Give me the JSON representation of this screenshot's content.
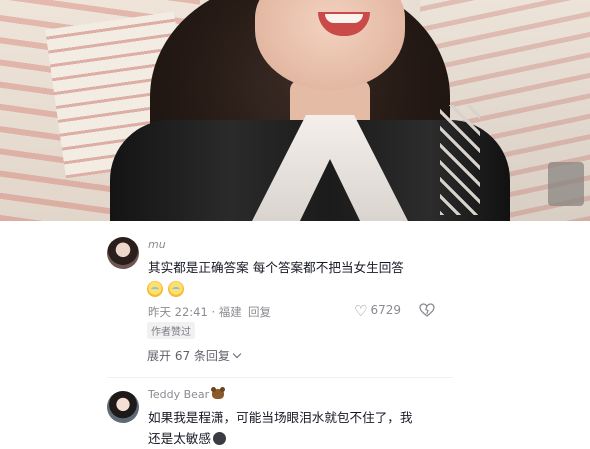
{
  "video": {
    "description_icon": "video-frame"
  },
  "comments": [
    {
      "author": "mu",
      "text": "其实都是正确答案 每个答案都不把当女生回答",
      "emojis": [
        "crying-face-emoji",
        "crying-face-emoji"
      ],
      "meta": "昨天 22:41 · 福建",
      "reply_label": "回复",
      "likes": "6729",
      "badge": "作者赞过",
      "expand_label": "展开 67 条回复"
    },
    {
      "author": "Teddy Bear",
      "text_line1": "如果我是程潇，可能当场眼泪水就包不住了，我",
      "text_line2": "还是太敏感"
    }
  ],
  "colors": {
    "text_primary": "#161823",
    "text_secondary": "#8a8b91"
  }
}
